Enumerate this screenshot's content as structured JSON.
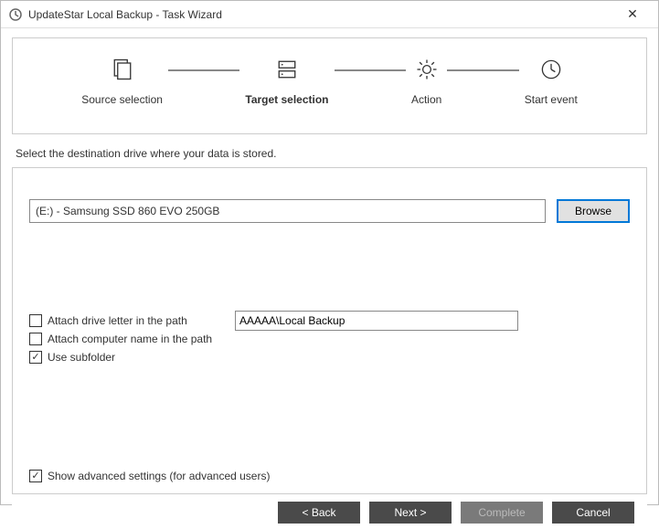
{
  "window": {
    "title": "UpdateStar Local Backup - Task Wizard"
  },
  "steps": {
    "source": "Source selection",
    "target": "Target selection",
    "action": "Action",
    "start": "Start event"
  },
  "instruction": "Select the destination drive where your data is stored.",
  "destination": {
    "path": "(E:) - Samsung SSD 860 EVO 250GB",
    "browse_label": "Browse"
  },
  "options": {
    "attach_drive_label": "Attach drive letter in the path",
    "attach_drive_checked": false,
    "attach_computer_label": "Attach computer name in the path",
    "attach_computer_checked": false,
    "use_subfolder_label": "Use subfolder",
    "use_subfolder_checked": true,
    "subfolder_value": "AAAAA\\Local Backup"
  },
  "advanced": {
    "label": "Show advanced settings (for advanced users)",
    "checked": true
  },
  "footer": {
    "back": "< Back",
    "next": "Next >",
    "complete": "Complete",
    "cancel": "Cancel"
  }
}
